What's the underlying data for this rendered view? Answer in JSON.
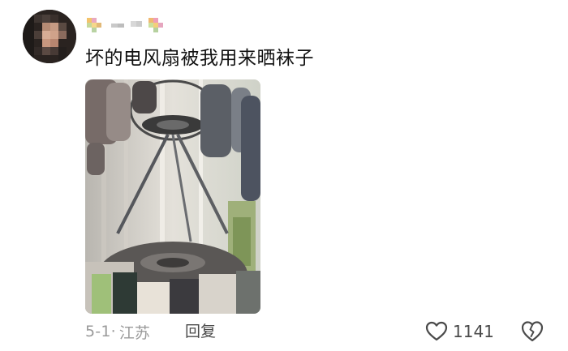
{
  "comment": {
    "text": "坏的电风扇被我用来晒袜子",
    "date": "5-1·",
    "location": "江苏",
    "reply_label": "回复",
    "like_count": "1141",
    "avatar_icon": "blurred-avatar-icon",
    "username_icon": "pixelated-username-icon",
    "like_icon": "heart-outline-icon",
    "dislike_icon": "broken-heart-icon"
  },
  "colors": {
    "text": "#111111",
    "meta": "#9a9a9a",
    "action": "#4a4a4a"
  }
}
